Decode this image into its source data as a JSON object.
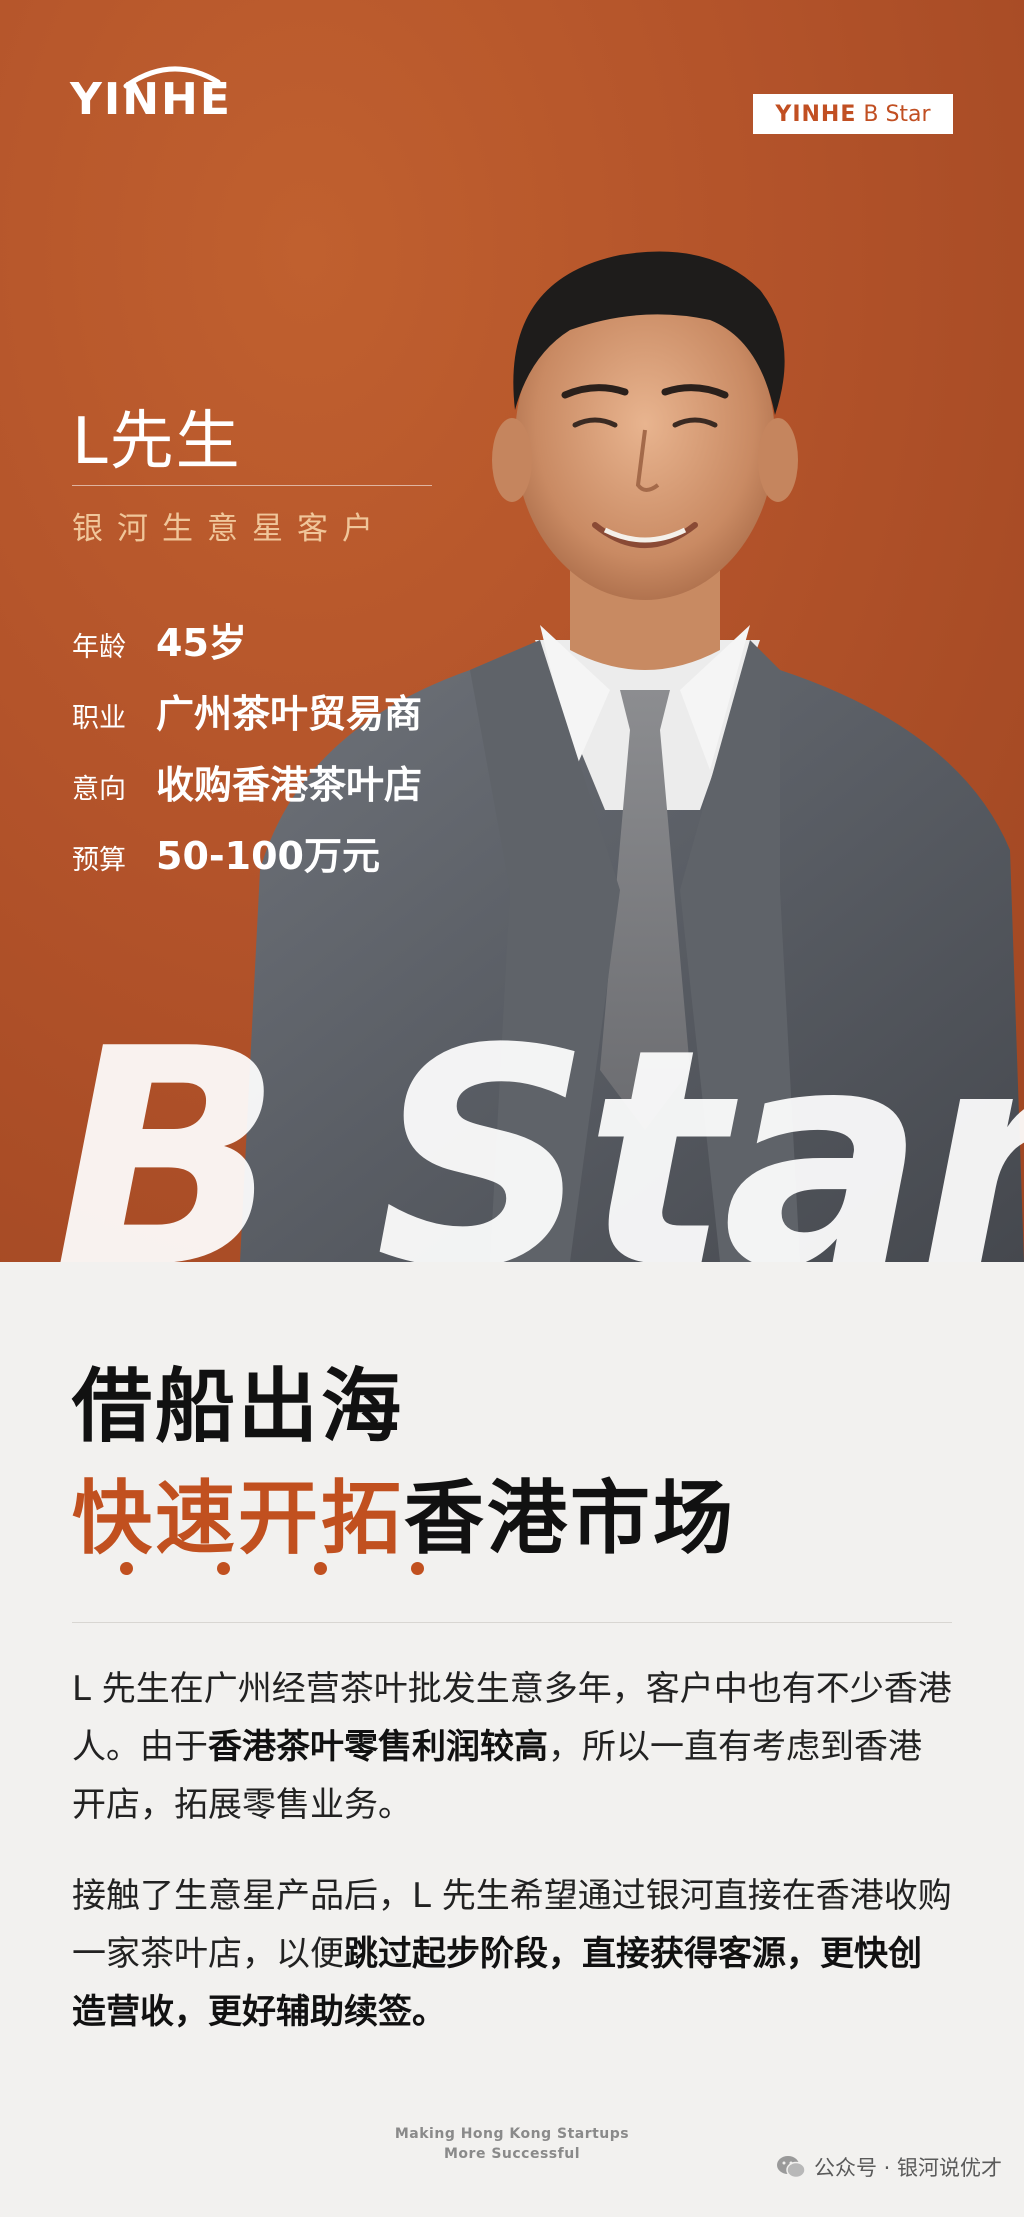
{
  "brand": {
    "logo": "YINHE",
    "badge_bold": "YINHE",
    "badge_light": "B Star"
  },
  "profile": {
    "name": "L先生",
    "subtitle": "银河生意星客户",
    "rows": [
      {
        "label": "年龄",
        "value": "45岁"
      },
      {
        "label": "职业",
        "value": "广州茶叶贸易商"
      },
      {
        "label": "意向",
        "value": "收购香港茶叶店"
      },
      {
        "label": "预算",
        "value": "50-100万元"
      }
    ]
  },
  "watermark": "B Star",
  "headline": {
    "line1": "借船出海",
    "line2_highlight": "快速开拓",
    "line2_rest": "香港市场"
  },
  "body": {
    "p1_a": "L 先生在广州经营茶叶批发生意多年，客户中也有不少香港人。由于",
    "p1_b": "香港茶叶零售利润较高",
    "p1_c": "，所以一直有考虑到香港开店，拓展零售业务。",
    "p2_a": "接触了生意星产品后，L 先生希望通过银河直接在香港收购一家茶叶店，以便",
    "p2_b": "跳过起步阶段，直接获得客源，更快创造营收，更好辅助续签。"
  },
  "footer": {
    "line1": "Making Hong Kong Startups",
    "line2": "More Successful"
  },
  "wechat": {
    "text": "公众号 · 银河说优才",
    "icon": "wechat-icon"
  },
  "colors": {
    "hero_bg": "#b5542a",
    "accent": "#c1501f",
    "subtitle": "#f0c69a",
    "paper": "#f2f1ef"
  }
}
